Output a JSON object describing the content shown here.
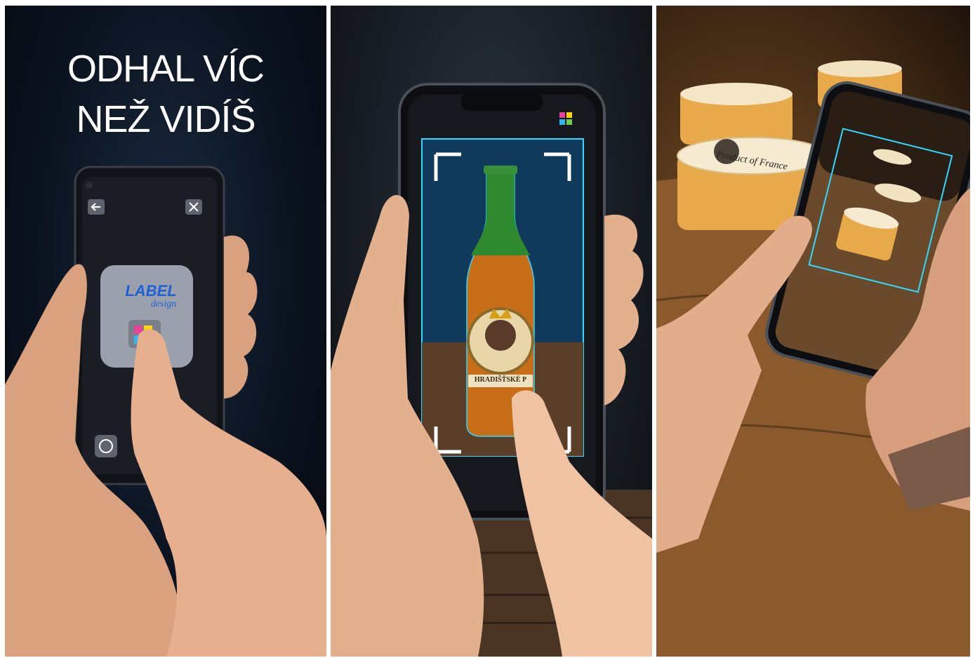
{
  "panels": [
    {
      "headline": {
        "line1": "ODHAL VÍC",
        "line2": "NEŽ VIDÍŠ"
      },
      "app_logo": {
        "word1": "LABEL",
        "word2": "design"
      },
      "icons": [
        "back-arrow-icon",
        "close-icon",
        "rotate-icon",
        "camera-icon"
      ]
    },
    {
      "scan_frame_color": "#2fd8ff",
      "bottle_label_text": "HRADIŠŤSKÉ P"
    },
    {
      "cheese_label_text": "Product of France",
      "scan_frame_color": "#2fd8ff"
    }
  ],
  "colors": {
    "accent_blue": "#2fd8ff",
    "logo_blue": "#1f5fd6"
  }
}
